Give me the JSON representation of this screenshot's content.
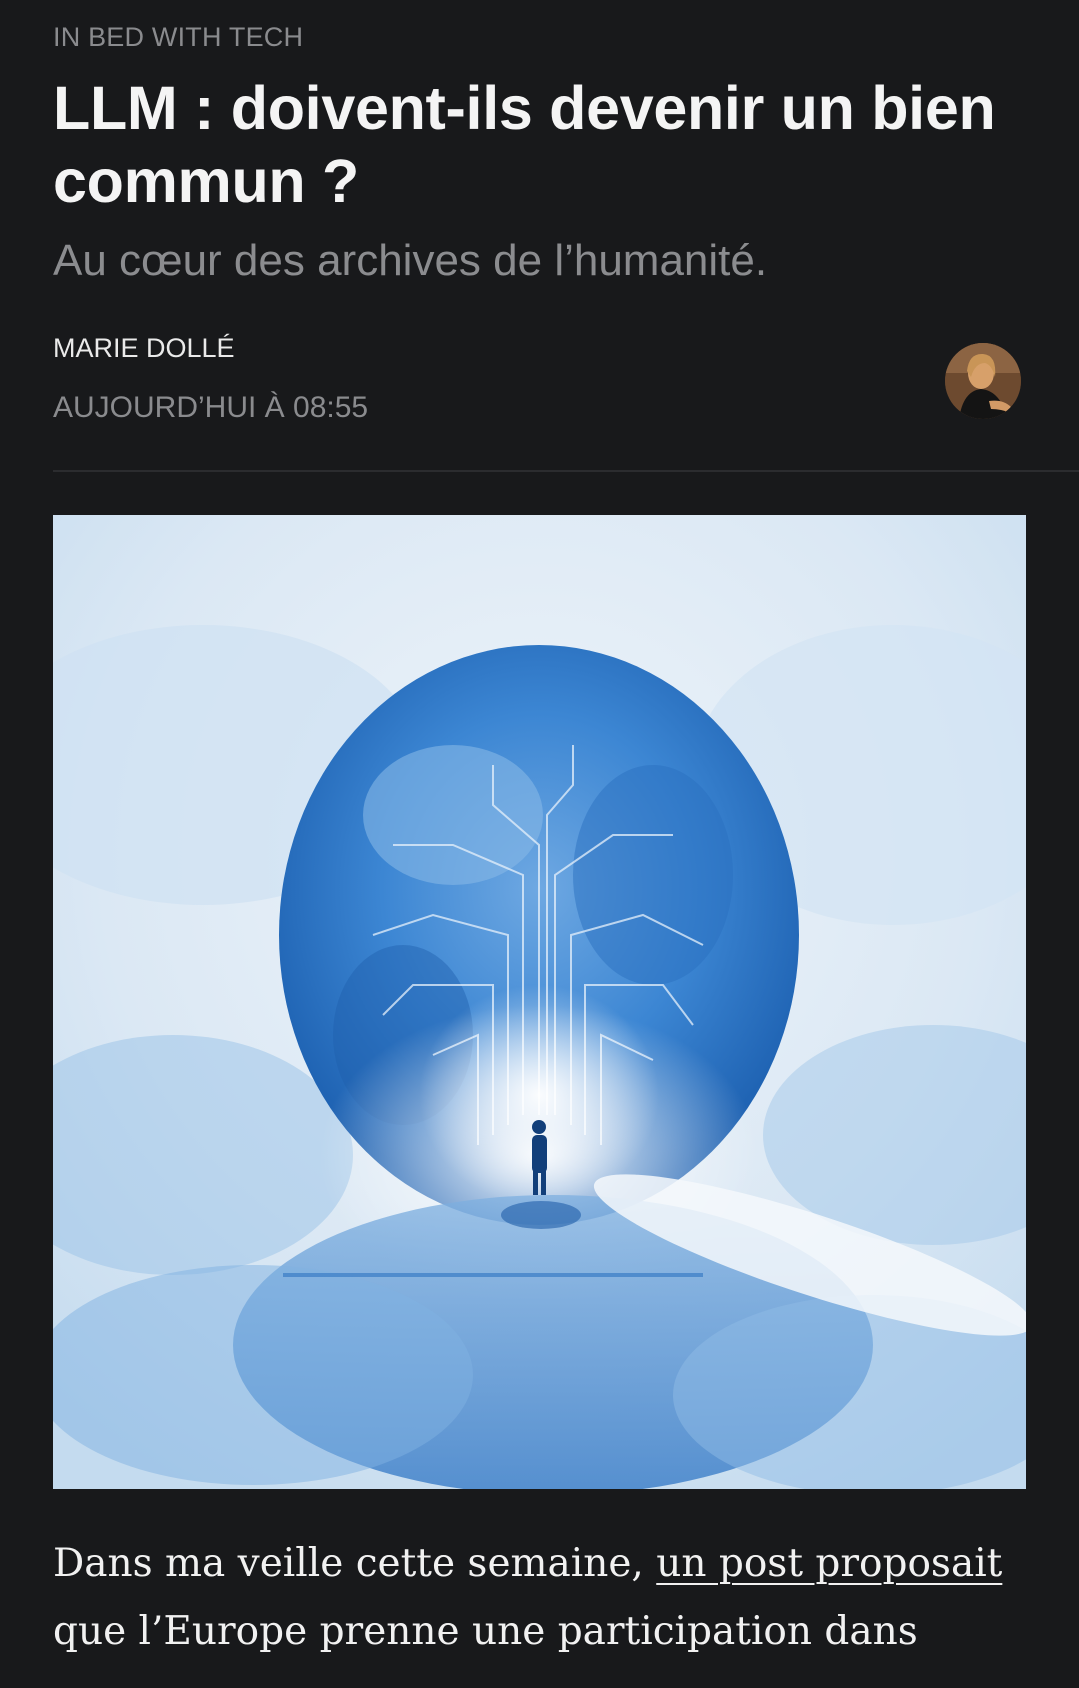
{
  "article": {
    "section": "IN BED WITH TECH",
    "title": "LLM : doivent-ils devenir un bien commun ?",
    "subtitle": "Au cœur des archives de l’humanité.",
    "author": "MARIE DOLLÉ",
    "timestamp": "AUJOURD’HUI À 08:55"
  },
  "body": {
    "intro_before_link": "Dans ma veille cette semaine, ",
    "link_text": "un post proposait",
    "intro_after_link": " que l’Europe prenne une participation dans"
  },
  "colors": {
    "background": "#18191b",
    "muted_text": "#8a8b8e",
    "hero_blue": "#2f7ccf"
  },
  "icons": {
    "avatar": "author-avatar"
  }
}
